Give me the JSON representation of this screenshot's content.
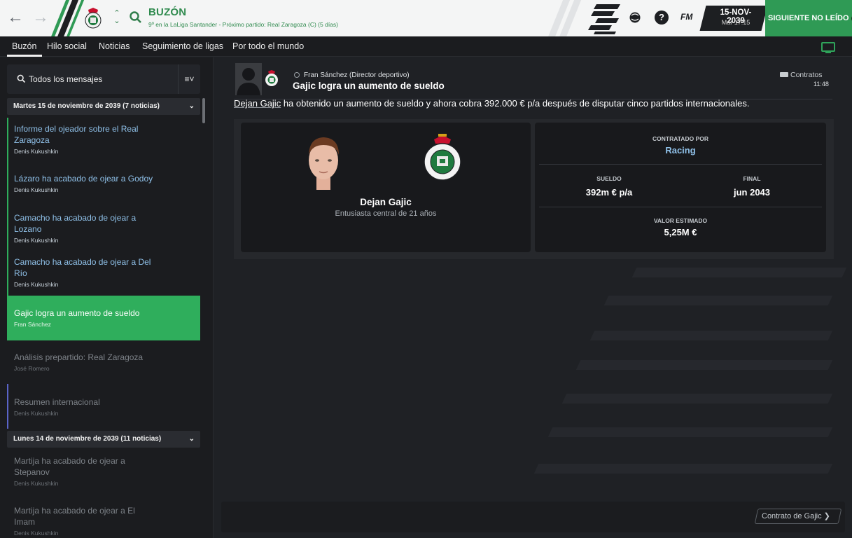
{
  "header": {
    "title": "BUZÓN",
    "subtitle": "9º en la LaLiga Santander - Próximo partido: Real Zaragoza (C) (5 días)",
    "date_main": "15-NOV-2039",
    "date_sub": "Mar 17:15",
    "next_button": "SIGUIENTE NO LEÍDO",
    "fm_label": "FM",
    "help_label": "?"
  },
  "tabs": [
    "Buzón",
    "Hilo social",
    "Noticias",
    "Seguimiento de ligas",
    "Por todo el mundo"
  ],
  "sidebar": {
    "search_label": "Todos los mensajes",
    "groups": [
      {
        "label": "Martes 15 de noviembre de 2039 (7 noticias)",
        "messages": [
          {
            "title": "Informe del ojeador sobre el Real Zaragoza",
            "author": "Denis Kukushkin",
            "state": "unread"
          },
          {
            "title": "Lázaro ha acabado de ojear a Godoy",
            "author": "Denis Kukushkin",
            "state": "unread"
          },
          {
            "title": "Camacho ha acabado de ojear a Lozano",
            "author": "Denis Kukushkin",
            "state": "unread"
          },
          {
            "title": "Camacho ha acabado de ojear a Del Río",
            "author": "Denis Kukushkin",
            "state": "unread"
          },
          {
            "title": "Gajic logra un aumento de sueldo",
            "author": "Fran Sánchez",
            "state": "selected"
          },
          {
            "title": "Análisis prepartido: Real Zaragoza",
            "author": "José Romero",
            "state": "read"
          },
          {
            "title": "Resumen internacional",
            "author": "Denis Kukushkin",
            "state": "read"
          }
        ]
      },
      {
        "label": "Lunes 14 de noviembre de 2039 (11 noticias)",
        "messages": [
          {
            "title": "Martija ha acabado de ojear a Stepanov",
            "author": "Denis Kukushkin",
            "state": "read"
          },
          {
            "title": "Martija ha acabado de ojear a El Imam",
            "author": "Denis Kukushkin",
            "state": "read"
          }
        ]
      }
    ]
  },
  "message": {
    "from": "Fran Sánchez",
    "from_role": "(Director deportivo)",
    "title": "Gajic logra un aumento de sueldo",
    "category": "Contratos",
    "time": "11:48",
    "body_link": "Dejan Gajic",
    "body_rest": " ha obtenido un aumento de sueldo y ahora cobra 392.000 € p/a después de disputar cinco partidos internacionales.",
    "player_name": "Dejan Gajic",
    "player_desc": "Entusiasta central de 21 años",
    "contracted_by_label": "CONTRATADO POR",
    "contracted_by": "Racing",
    "salary_label": "SUELDO",
    "salary": "392m € p/a",
    "end_label": "FINAL",
    "end": "jun 2043",
    "value_label": "VALOR ESTIMADO",
    "value": "5,25M €",
    "action_button": "Contrato de Gajic"
  },
  "colors": {
    "accent_green": "#2fae5c",
    "link_blue": "#8fc0e8",
    "bg_dark": "#1e2024"
  },
  "icons": [
    "back-arrow-icon",
    "forward-arrow-icon",
    "club-crest-icon",
    "search-icon",
    "filter-icon",
    "chevron-down-icon",
    "help-icon",
    "globe-icon",
    "monitor-icon",
    "tag-icon",
    "chevron-right-icon"
  ]
}
